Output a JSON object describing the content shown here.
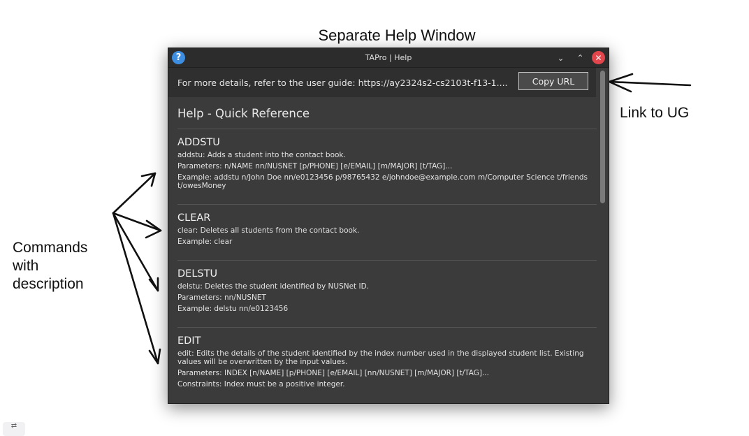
{
  "annotations": {
    "window_heading": "Separate Help Window",
    "link_label": "Link to UG",
    "commands_label": "Commands with description"
  },
  "window": {
    "title": "TAPro | Help",
    "help_icon": "?",
    "minimize_glyph": "⌄",
    "maximize_glyph": "⌃",
    "close_glyph": "✕"
  },
  "urlbar": {
    "text": "For more details, refer to the user guide: https://ay2324s2-cs2103t-f13-1....",
    "button": "Copy URL"
  },
  "help": {
    "title": "Help - Quick Reference",
    "commands": [
      {
        "name": "ADDSTU",
        "lines": [
          "addstu: Adds a student into the contact book.",
          "Parameters: n/NAME nn/NUSNET [p/PHONE] [e/EMAIL] [m/MAJOR] [t/TAG]...",
          "Example: addstu n/John Doe nn/e0123456 p/98765432 e/johndoe@example.com m/Computer Science t/friends t/owesMoney"
        ]
      },
      {
        "name": "CLEAR",
        "lines": [
          "clear: Deletes all students from the contact book.",
          "Example: clear"
        ]
      },
      {
        "name": "DELSTU",
        "lines": [
          "delstu: Deletes the student identified by NUSNet ID.",
          "Parameters: nn/NUSNET",
          "Example: delstu nn/e0123456"
        ]
      },
      {
        "name": "EDIT",
        "lines": [
          "edit: Edits the details of the student identified by the index number used in the displayed student list. Existing values will be overwritten by the input values.",
          "Parameters: INDEX [n/NAME] [p/PHONE] [e/EMAIL] [nn/NUSNET] [m/MAJOR] [t/TAG]...",
          "Constraints: Index must be a positive integer."
        ]
      }
    ]
  },
  "corner_glyph": "⇄"
}
